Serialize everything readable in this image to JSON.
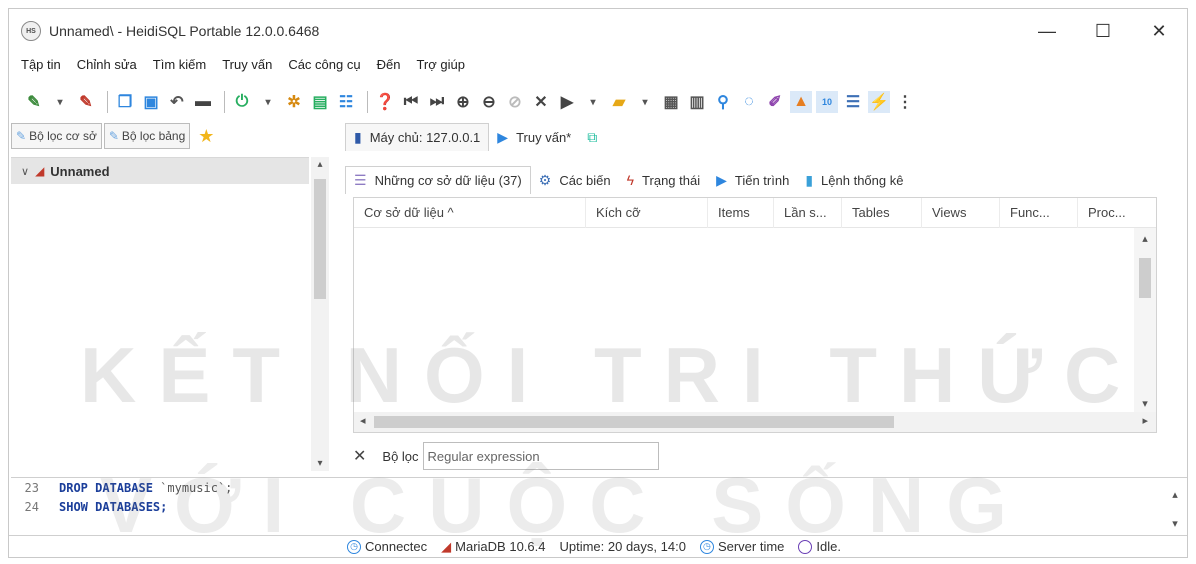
{
  "window": {
    "app_icon_text": "HS",
    "title": "Unnamed\\ - HeidiSQL Portable 12.0.0.6468",
    "controls": {
      "minimize": "—",
      "maximize": "☐",
      "close": "✕"
    }
  },
  "menu": [
    "Tập tin",
    "Chỉnh sửa",
    "Tìm kiếm",
    "Truy vấn",
    "Các công cụ",
    "Đến",
    "Trợ giúp"
  ],
  "left": {
    "filter_db": "Bộ lọc cơ sở",
    "filter_table": "Bộ lọc bảng",
    "tree_root": "Unnamed"
  },
  "tabs": {
    "host": "Máy chủ: 127.0.0.1",
    "query": "Truy vấn*"
  },
  "subtabs": {
    "databases": "Những cơ sở dữ liệu (37)",
    "variables": "Các biến",
    "status": "Trạng thái",
    "processes": "Tiến trình",
    "command_stats": "Lệnh thống kê"
  },
  "grid": {
    "columns": [
      "Cơ sở dữ liệu ^",
      "Kích cỡ",
      "Items",
      "Lần s...",
      "Tables",
      "Views",
      "Func...",
      "Proc..."
    ]
  },
  "filter": {
    "label": "Bộ lọc",
    "placeholder": "Regular expression"
  },
  "sql_log": [
    {
      "num": "23",
      "kw1": "DROP DATABASE",
      "rest": " `mymusic`;"
    },
    {
      "num": "24",
      "kw1": "SHOW DATABASES",
      "rest": ";"
    }
  ],
  "status": {
    "connected": "Connectec",
    "server": "MariaDB 10.6.4",
    "uptime": "Uptime: 20 days, 14:0",
    "server_time": "Server time",
    "idle": "Idle."
  },
  "watermark": {
    "line1": "KẾT NỐI TRI THỨC",
    "line2": "VỚI CUỘC SỐNG"
  },
  "colors": {
    "accent": "#2e86de",
    "tree_selected": "#e5e5e5",
    "keyword": "#1b3e9a"
  }
}
